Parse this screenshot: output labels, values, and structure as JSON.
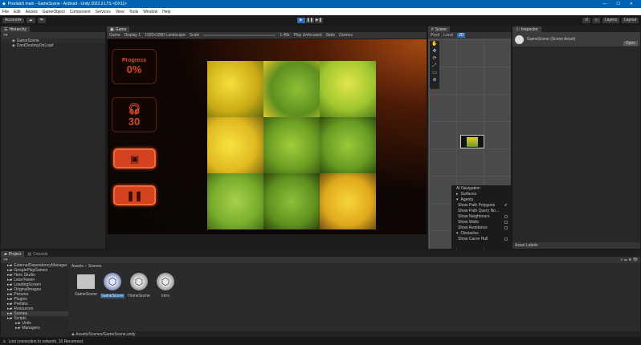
{
  "window": {
    "title": "Pixelatch main - GameScene - Android - Unity 2022.3 LTS <DX11>",
    "minimize": "—",
    "maximize": "☐",
    "close": "✕"
  },
  "menu": [
    "File",
    "Edit",
    "Assets",
    "GameObject",
    "Component",
    "Services",
    "View",
    "Tools",
    "Window",
    "Help"
  ],
  "toolbar": {
    "account": "Account",
    "layers": "Layers",
    "layout": "Layout"
  },
  "hierarchy": {
    "tab": "Hierarchy",
    "items": [
      "GameScene",
      "DontDestroyOnLoad"
    ]
  },
  "game": {
    "tab": "Game",
    "mode": "Game",
    "display": "Display 1",
    "resolution": "1920x1080 Landscape",
    "scale_label": "Scale",
    "scale_value": "1.48x",
    "play_mode": "Play Unfocused",
    "stats": "Stats",
    "gizmos": "Gizmos",
    "hud": {
      "progress_label": "Progress",
      "progress_value": "0%",
      "moves_value": "30",
      "progress_percent": 0
    },
    "colors": {
      "accent": "#e0471c",
      "button": "#d4431d"
    }
  },
  "scene": {
    "tab": "Scene",
    "pivot": "Pivot",
    "local": "Local",
    "view": "2D",
    "overlay": {
      "title": "AI Navigation",
      "items": [
        {
          "label": "Surfaces",
          "type": "section"
        },
        {
          "label": "Agents",
          "type": "section"
        },
        {
          "label": "Show Path Polygons",
          "type": "check",
          "checked": true
        },
        {
          "label": "Show Path Query No...",
          "type": "check",
          "checked": false
        },
        {
          "label": "Show Neighbours",
          "type": "check",
          "checked": false
        },
        {
          "label": "Show Walls",
          "type": "check",
          "checked": false
        },
        {
          "label": "Show Avoidance",
          "type": "check",
          "checked": false
        },
        {
          "label": "Obstacles",
          "type": "section"
        },
        {
          "label": "Show Carve Hull",
          "type": "check",
          "checked": false
        }
      ]
    }
  },
  "inspector": {
    "tab": "Inspector",
    "asset": "GameScene (Scene Asset)",
    "open": "Open",
    "labels": "Asset Labels"
  },
  "project": {
    "tabs": [
      "Project",
      "Console"
    ],
    "breadcrumb": [
      "Assets",
      "Scenes"
    ],
    "folders": [
      "ExternalDependencyManager",
      "GooglePlayGames",
      "Hero Studio",
      "LeanTween",
      "LoadingScreen",
      "OriginalImages",
      "Pictures",
      "Plugins",
      "Prefabs",
      "Resources",
      "Scenes",
      "Scripts",
      "Units",
      "Managers"
    ],
    "selected_folder": "Scenes",
    "assets": [
      {
        "name": "GameScene",
        "kind": "folder"
      },
      {
        "name": "GameScene",
        "kind": "scene",
        "selected": true
      },
      {
        "name": "HomeScene",
        "kind": "scene"
      },
      {
        "name": "Intro",
        "kind": "scene"
      }
    ],
    "path": "Assets/Scenes/GameScene.unity"
  },
  "status": {
    "message": "Lost connection to network. 10 Reconnect"
  }
}
